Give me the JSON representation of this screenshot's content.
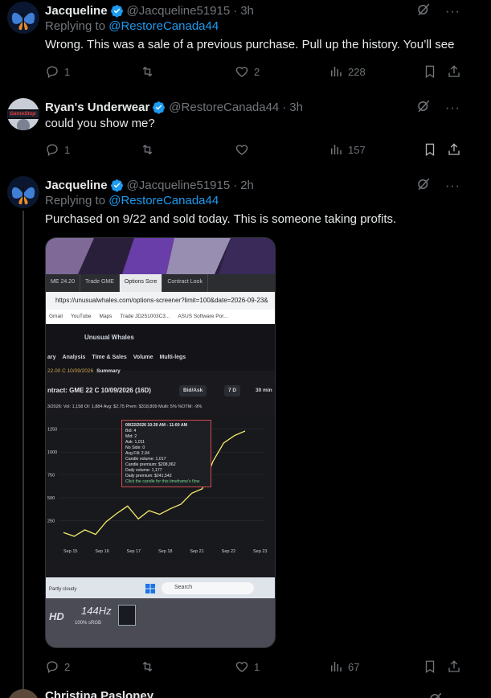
{
  "tweets": [
    {
      "name": "Jacqueline",
      "handle": "@Jacqueline51915",
      "time": "3h",
      "replying_prefix": "Replying to ",
      "replying_to": "@RestoreCanada44",
      "text": "Wrong. This was a sale of a previous purchase. Pull up the history. You’ll see",
      "replies": "1",
      "retweets": "",
      "likes": "2",
      "views": "228"
    },
    {
      "name": "Ryan's Underwear",
      "handle": "@RestoreCanada44",
      "time": "3h",
      "avatar_text": "GameStop",
      "text": "could you show me?",
      "replies": "1",
      "retweets": "",
      "likes": "",
      "views": "157"
    },
    {
      "name": "Jacqueline",
      "handle": "@Jacqueline51915",
      "time": "2h",
      "replying_prefix": "Replying to ",
      "replying_to": "@RestoreCanada44",
      "text": "Purchased on 9/22 and sold today. This is someone taking profits.",
      "replies": "2",
      "retweets": "",
      "likes": "1",
      "views": "67"
    }
  ],
  "dot": "·",
  "more": "···",
  "photo": {
    "tabs": [
      "ME 24.20",
      "Trade GME",
      "Options Scre",
      "Contract Look"
    ],
    "url": "https://unusualwhales.com/options-screener?limit=100&date=2026-09-23&",
    "bookmarks": [
      "Gmail",
      "YouTube",
      "Maps",
      "Trade JD251003C3...",
      "ASUS Software Por..."
    ],
    "brand": "Unusual Whales",
    "nav": [
      "ary",
      "Analysis",
      "Time & Sales",
      "Volume",
      "Multi-legs"
    ],
    "contract_sub": "22.00 C 10/09/2026",
    "summary": "Summary",
    "contract_label": "ntract: GME 22 C 10/09/2026",
    "dte": "(16D)",
    "bidask": "Bid/Ask",
    "range": "7 D",
    "interval": "30 min",
    "stats": "3/2026:  Vol: 1,158   OI: 1,884   Avg: $2.75   Prem: $318,809   Multi: 5%   %OTM: -9%",
    "taskbar_search": "Search",
    "weather": "Partly cloudy",
    "monitor_hz": "HD",
    "monitor_rate": "144Hz",
    "monitor_srgb": "100% sRGB"
  },
  "chart_data": {
    "type": "line",
    "title": "",
    "x": [
      "Sep 15",
      "Sep 16",
      "Sep 17",
      "Sep 18",
      "Sep 21",
      "Sep 22",
      "Sep 23"
    ],
    "y_ticks": [
      250,
      500,
      750,
      1000,
      1250
    ],
    "ylim": [
      0,
      1300
    ],
    "series": [
      {
        "values": [
          120,
          80,
          150,
          100,
          240,
          330,
          410,
          270,
          360,
          320,
          380,
          430,
          550,
          600,
          900,
          1100,
          1180,
          1230
        ]
      }
    ],
    "tooltip": [
      "09/22/2026 10:30 AM - 11:00 AM",
      "Bid: 4",
      "Mid: 2",
      "Ask: 1,011",
      "No Side: 0",
      "Avg Fill: 2.04",
      "Candle volume: 1,017",
      "Candle premium: $208,062",
      "Daily volume: 1,177",
      "Daily premium: $241,542",
      "Click the candle for this timeframe's flow"
    ],
    "legend": "Unusual Whales",
    "grid": true
  },
  "bottom": {
    "name": "Christina Pasloney"
  }
}
